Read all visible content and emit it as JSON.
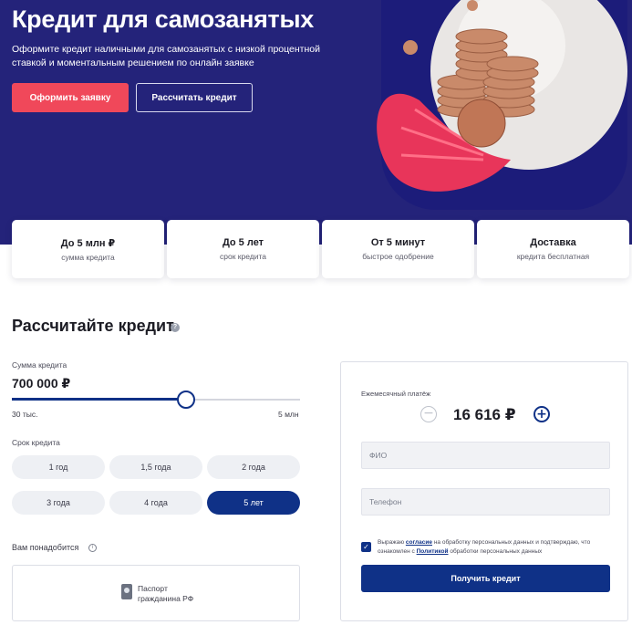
{
  "hero": {
    "title": "Кредит для самозанятых",
    "subtitle": "Оформите кредит наличными для самозанятых с низкой процентной ставкой и моментальным решением по онлайн заявке",
    "apply_label": "Оформить заявку",
    "calculate_label": "Рассчитать кредит"
  },
  "features": [
    {
      "title": "До 5 млн ₽",
      "subtitle": "сумма кредита"
    },
    {
      "title": "До 5 лет",
      "subtitle": "срок кредита"
    },
    {
      "title": "От 5 минут",
      "subtitle": "быстрое одобрение"
    },
    {
      "title": "Доставка",
      "subtitle": "кредита бесплатная"
    }
  ],
  "calculator": {
    "title": "Рассчитайте кредит",
    "help_glyph": "?",
    "amount_label": "Сумма кредита",
    "amount_value": "700 000 ₽",
    "slider_fraction": 0.6,
    "min_label": "30 тыс.",
    "max_label": "5 млн",
    "term_label": "Срок кредита",
    "terms": [
      "1 год",
      "1,5 года",
      "2 года",
      "3 года",
      "4 года",
      "5 лет"
    ],
    "selected_term": "5 лет",
    "need_label": "Вам понадобится",
    "info_glyph": "i",
    "document": "Паспорт\nгражданина РФ"
  },
  "result": {
    "payment_label": "Ежемесячный платёж",
    "payment_value": "16 616 ₽",
    "minus_glyph": "−",
    "plus_glyph": "+",
    "name_placeholder": "ФИО",
    "phone_placeholder": "Телефон",
    "check_glyph": "✓",
    "consent_pre": "Выражаю",
    "consent_link": "согласие",
    "consent_mid": "на обработку персональных данных и подтверждаю, что ознакомлен с",
    "policy_link": "Политикой",
    "consent_post": "обработки персональных данных",
    "submit_label": "Получить кредит"
  },
  "colors": {
    "hero_bg": "#24237a",
    "accent_red": "#f0485a",
    "primary_blue": "#0f3187"
  },
  "icons": [
    "help-icon",
    "info-icon",
    "passport-icon",
    "minus-icon",
    "plus-icon",
    "checkbox-check-icon"
  ]
}
